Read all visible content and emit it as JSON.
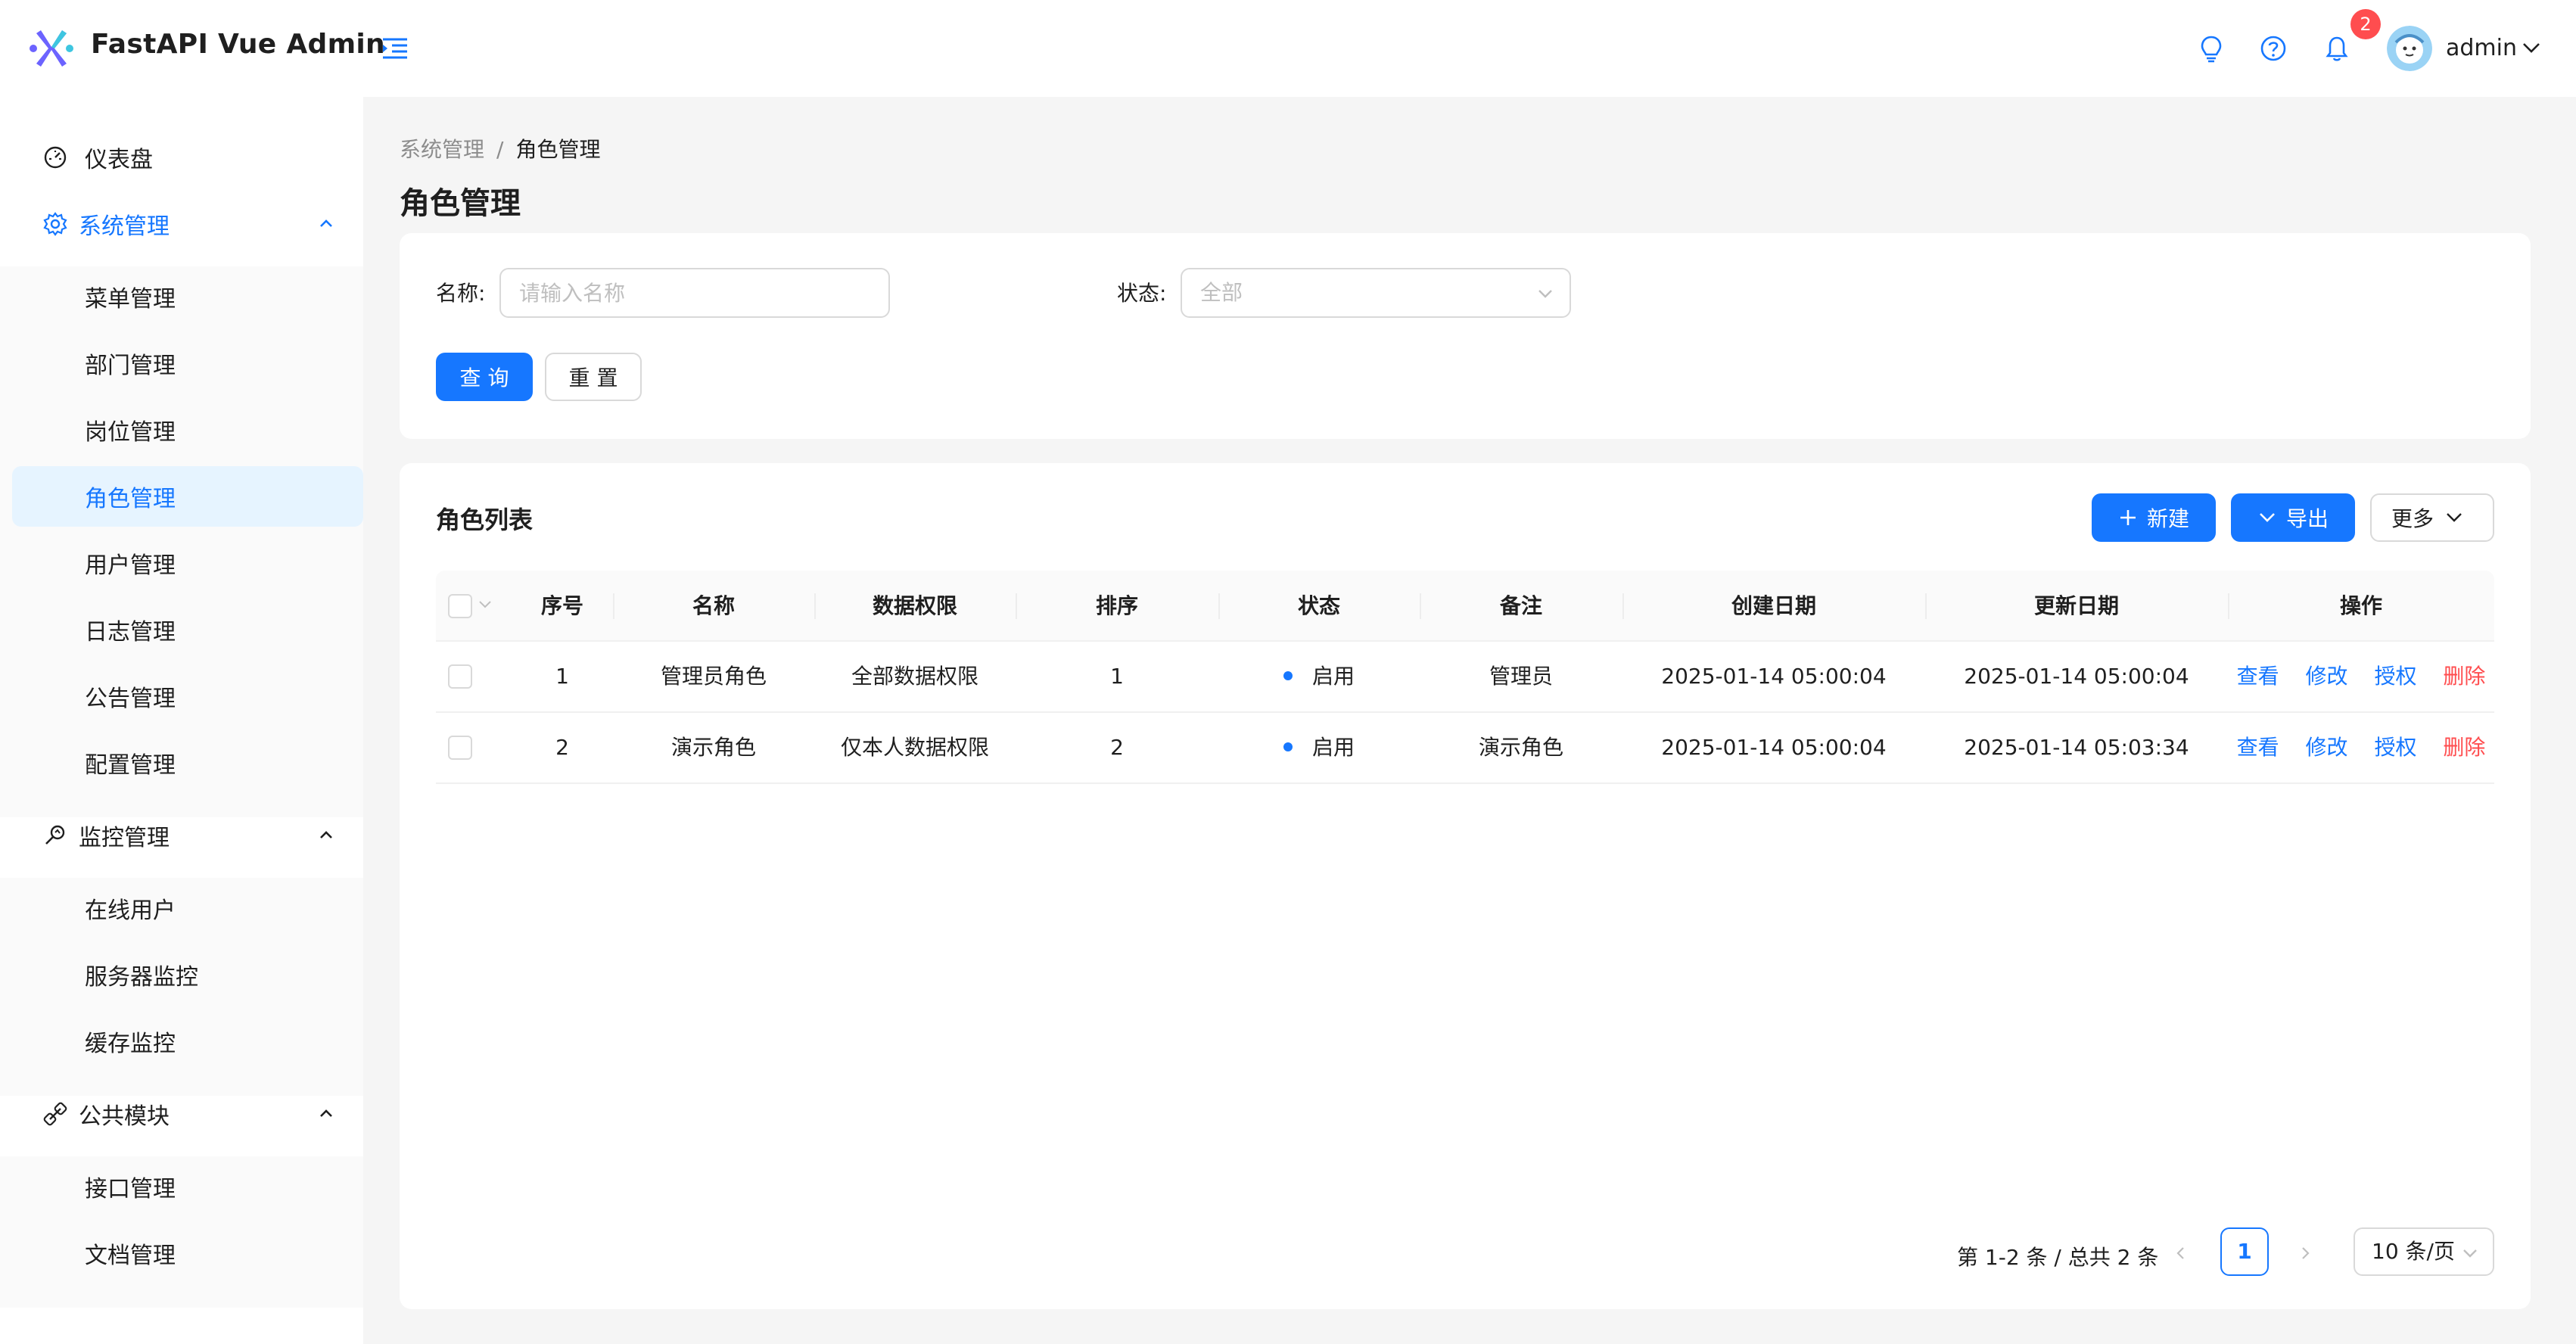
{
  "header": {
    "app_title": "FastAPI Vue Admin",
    "notification_count": "2",
    "user_name": "admin",
    "icons": [
      "logo-icon",
      "menu-collapse-icon",
      "bulb-icon",
      "question-circle-icon",
      "bell-icon",
      "avatar",
      "chevron-down-icon"
    ]
  },
  "sidebar": {
    "dashboard": "仪表盘",
    "system": {
      "label": "系统管理",
      "items": [
        "菜单管理",
        "部门管理",
        "岗位管理",
        "角色管理",
        "用户管理",
        "日志管理",
        "公告管理",
        "配置管理"
      ]
    },
    "monitor": {
      "label": "监控管理",
      "items": [
        "在线用户",
        "服务器监控",
        "缓存监控"
      ]
    },
    "common": {
      "label": "公共模块",
      "items": [
        "接口管理",
        "文档管理"
      ]
    },
    "active_item": "角色管理"
  },
  "breadcrumb": {
    "parent": "系统管理",
    "separator": "/",
    "current": "角色管理"
  },
  "page_title": "角色管理",
  "search": {
    "name_label": "名称:",
    "name_placeholder": "请输入名称",
    "status_label": "状态:",
    "status_value": "全部",
    "query_button": "查 询",
    "reset_button": "重 置"
  },
  "list": {
    "title": "角色列表",
    "new_button": "新建",
    "export_button": "导出",
    "more_button": "更多",
    "columns": [
      "序号",
      "名称",
      "数据权限",
      "排序",
      "状态",
      "备注",
      "创建日期",
      "更新日期",
      "操作"
    ],
    "rows": [
      {
        "index": "1",
        "name": "管理员角色",
        "data_scope": "全部数据权限",
        "order": "1",
        "status": "启用",
        "remark": "管理员",
        "created": "2025-01-14 05:00:04",
        "updated": "2025-01-14 05:00:04"
      },
      {
        "index": "2",
        "name": "演示角色",
        "data_scope": "仅本人数据权限",
        "order": "2",
        "status": "启用",
        "remark": "演示角色",
        "created": "2025-01-14 05:00:04",
        "updated": "2025-01-14 05:03:34"
      }
    ],
    "actions": {
      "view": "查看",
      "edit": "修改",
      "authorize": "授权",
      "delete": "删除"
    }
  },
  "pagination": {
    "total_text": "第 1-2 条 / 总共 2 条",
    "current_page": "1",
    "page_size": "10 条/页"
  },
  "colors": {
    "primary": "#1677ff",
    "danger": "#ff4d4f",
    "active_bg": "#e6f4ff",
    "page_bg": "#f5f5f5"
  }
}
